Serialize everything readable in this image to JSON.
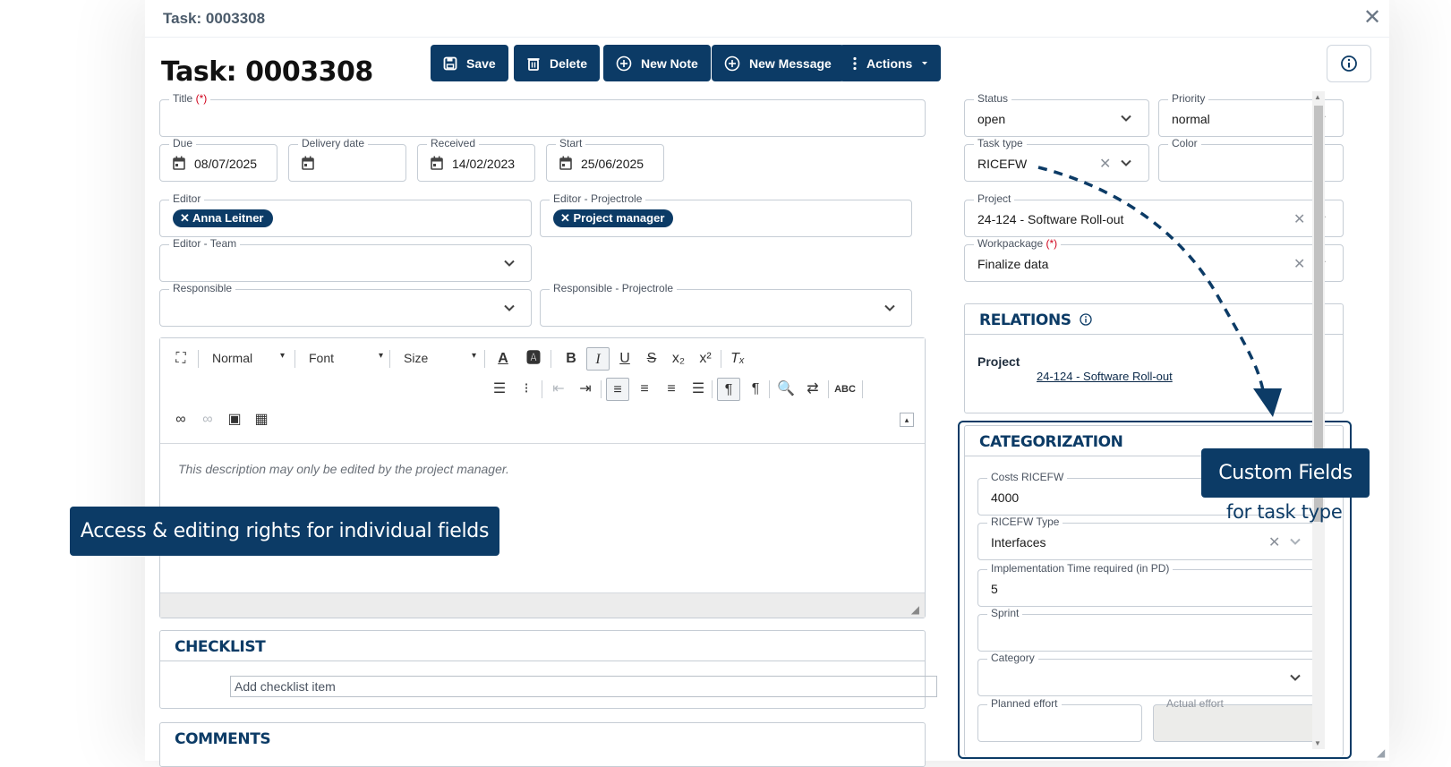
{
  "modal": {
    "header_title": "Task: 0003308",
    "close_glyph": "✕",
    "page_title": "Task: 0003308"
  },
  "toolbar": {
    "save": "Save",
    "delete": "Delete",
    "new_note": "New Note",
    "new_message": "New Message",
    "actions": "Actions"
  },
  "fields": {
    "title": {
      "label": "Title",
      "required": "(*)",
      "value": ""
    },
    "due": {
      "label": "Due",
      "value": "08/07/2025"
    },
    "delivery": {
      "label": "Delivery date",
      "value": ""
    },
    "received": {
      "label": "Received",
      "value": "14/02/2023"
    },
    "start": {
      "label": "Start",
      "value": "25/06/2025"
    },
    "editor": {
      "label": "Editor",
      "chip": "Anna Leitner"
    },
    "editor_role": {
      "label": "Editor - Projectrole",
      "chip": "Project manager"
    },
    "editor_team": {
      "label": "Editor - Team",
      "value": ""
    },
    "responsible": {
      "label": "Responsible",
      "value": ""
    },
    "responsible_role": {
      "label": "Responsible - Projectrole",
      "value": ""
    },
    "status": {
      "label": "Status",
      "value": "open"
    },
    "priority": {
      "label": "Priority",
      "value": "normal"
    },
    "task_type": {
      "label": "Task type",
      "value": "RICEFW"
    },
    "color": {
      "label": "Color",
      "value": ""
    },
    "project": {
      "label": "Project",
      "value": "24-124 - Software Roll-out"
    },
    "workpackage": {
      "label": "Workpackage",
      "required": "(*)",
      "value": "Finalize data"
    }
  },
  "editor_toolbar": {
    "format": "Normal",
    "font": "Font",
    "size": "Size",
    "placeholder": "This description may only be edited by the project manager."
  },
  "relations": {
    "title": "RELATIONS",
    "row_label": "Project",
    "row_link": "24-124 - Software Roll-out"
  },
  "categorization": {
    "title": "CATEGORIZATION",
    "costs": {
      "label": "Costs RICEFW",
      "value": "4000"
    },
    "ricefw_type": {
      "label": "RICEFW Type",
      "value": "Interfaces"
    },
    "impl_time": {
      "label": "Implementation Time required (in PD)",
      "value": "5"
    },
    "sprint": {
      "label": "Sprint",
      "value": ""
    },
    "category": {
      "label": "Category",
      "value": ""
    },
    "planned": {
      "label": "Planned effort",
      "value": ""
    },
    "actual": {
      "label": "Actual effort",
      "value": ""
    }
  },
  "checklist": {
    "title": "CHECKLIST",
    "placeholder": "Add checklist item"
  },
  "comments": {
    "title": "COMMENTS"
  },
  "callouts": {
    "access": "Access & editing rights for individual fields",
    "custom_fields": "Custom Fields",
    "custom_fields_sub": "for task type"
  },
  "colors": {
    "primary": "#0c3b66",
    "required": "#d0021b",
    "border": "#c6cdd5"
  },
  "icons": [
    "save-icon",
    "trash-icon",
    "plus-circle-icon",
    "more-vertical-icon",
    "info-icon",
    "calendar-icon",
    "chevron-down-icon",
    "close-icon"
  ]
}
